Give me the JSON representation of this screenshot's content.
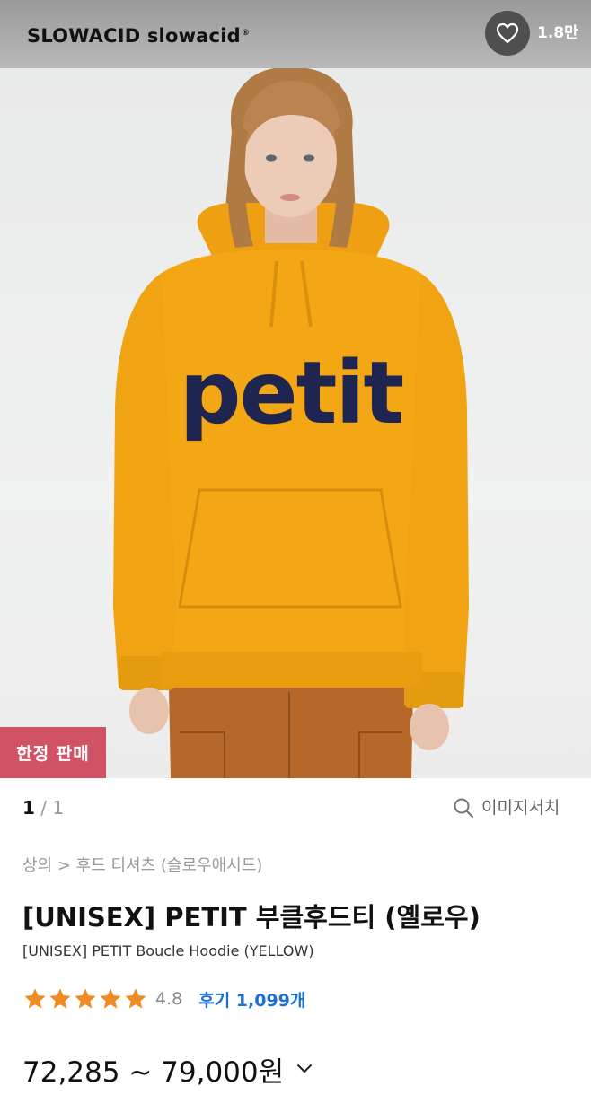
{
  "header": {
    "brand": "SLOWACID slowacid",
    "brand_mark": "®",
    "like_icon": "heart-outline-icon",
    "like_count": "1.8만"
  },
  "product_image": {
    "print_text": "petit",
    "badge": "한정 판매",
    "colors": {
      "hoodie": "#f4a715",
      "print": "#1d2550",
      "pants": "#b5682a",
      "badge": "#d05264"
    }
  },
  "pager": {
    "current": "1",
    "separator": "/",
    "total": "1",
    "search_icon": "search-icon",
    "image_search_label": "이미지서치"
  },
  "product": {
    "breadcrumb": "상의 > 후드 티셔츠 (슬로우애시드)",
    "title": "[UNISEX] PETIT 부클후드티 (옐로우)",
    "subtitle": "[UNISEX] PETIT Boucle Hoodie (YELLOW)",
    "rating_stars": 4.8,
    "rating": "4.8",
    "reviews": "후기 1,099개",
    "price": "72,285 ~ 79,000원",
    "price_chevron": "chevron-down-icon",
    "star_color": "#f08a24",
    "review_color": "#1e6fd1"
  }
}
